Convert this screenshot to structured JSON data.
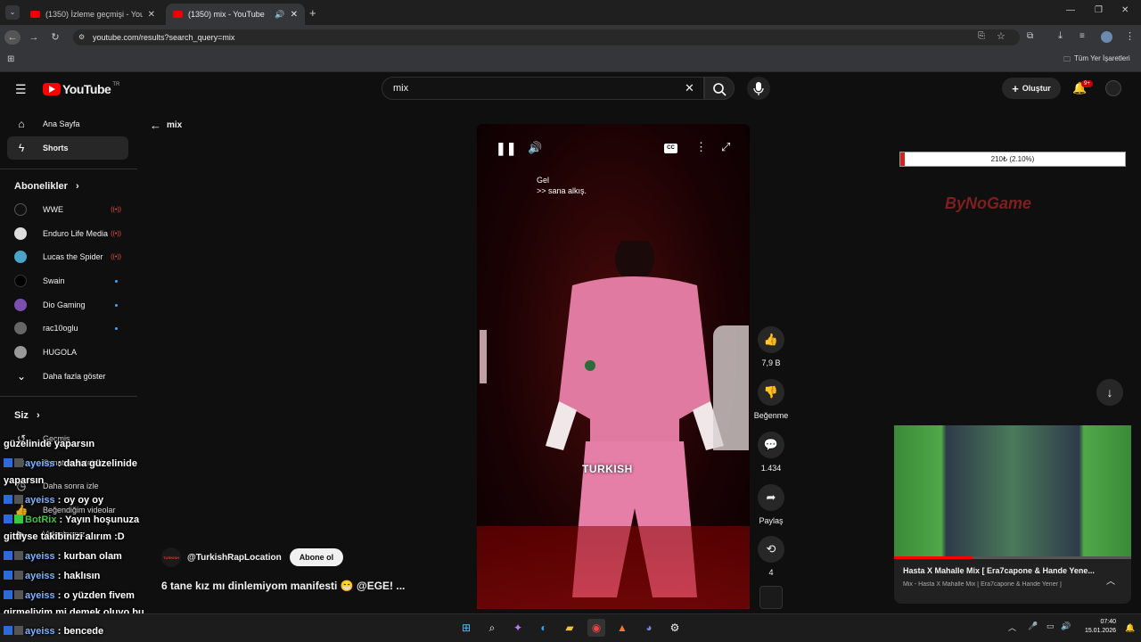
{
  "browser": {
    "tabs": [
      {
        "title": "(1350) İzleme geçmişi - YouTube"
      },
      {
        "title": "(1350) mix - YouTube"
      }
    ],
    "url": "youtube.com/results?search_query=mix",
    "bookmarks_label": "Tüm Yer İşaretleri"
  },
  "header": {
    "logo": "YouTube",
    "region": "TR",
    "search_value": "mix",
    "create_label": "Oluştur",
    "notif_count": "9+"
  },
  "sidebar": {
    "home": "Ana Sayfa",
    "shorts": "Shorts",
    "subs_title": "Abonelikler",
    "subs": [
      {
        "name": "WWE",
        "status": "live"
      },
      {
        "name": "Enduro Life Media",
        "status": "live"
      },
      {
        "name": "Lucas the Spider",
        "status": "live"
      },
      {
        "name": "Swain",
        "status": "new"
      },
      {
        "name": "Dio Gaming",
        "status": "new"
      },
      {
        "name": "rac10oglu",
        "status": "new"
      },
      {
        "name": "HUGOLA",
        "status": ""
      }
    ],
    "more": "Daha fazla göster",
    "you_title": "Siz",
    "you_items": [
      "Geçmiş",
      "Oynatma listeleri",
      "Daha sonra izle",
      "Beğendiğim videolar",
      "Videolarınız"
    ]
  },
  "chat": [
    {
      "user": "",
      "text": "güzelinide yaparsın"
    },
    {
      "user": "ayeiss",
      "text": "daha güzelinide"
    },
    {
      "user": "",
      "text": "yaparsın"
    },
    {
      "user": "ayeiss",
      "text": "oy oy oy"
    },
    {
      "user": "BotRix",
      "text": "Yayın hoşunuza"
    },
    {
      "user": "",
      "text": "gittiyse takibinizi alırım :D"
    },
    {
      "user": "ayeiss",
      "text": "kurban olam"
    },
    {
      "user": "ayeiss",
      "text": "haklısın"
    },
    {
      "user": "ayeiss",
      "text": "o yüzden fivem"
    },
    {
      "user": "",
      "text": "girmeliyim mi demek oluyo bu"
    },
    {
      "user": "ayeiss",
      "text": "bencede"
    }
  ],
  "back_query": "mix",
  "short": {
    "caption_line1": "Gel",
    "caption_line2": ">> sana alkış.",
    "watermark": "TURKISH",
    "channel": "@TurkishRapLocation",
    "subscribe": "Abone ol",
    "title": "6 tane kız mı dinlemiyom manifesti 😁 @EGE! ...",
    "likes": "7,9 B",
    "dislike_label": "Beğenme",
    "comments": "1.434",
    "share_label": "Paylaş",
    "remix_count": "4"
  },
  "overlay": {
    "progress_text": "210₺ (2.10%)",
    "progress_percent": 2.1,
    "brand": "ByNoGame"
  },
  "miniplayer": {
    "title": "Hasta X Mahalle Mix [ Era7capone & Hande Yene...",
    "subtitle": "Mix - Hasta X Mahalle Mix [ Era7capone & Hande Yener ]"
  },
  "taskbar": {
    "time": "07:40",
    "date": "15.01.2026"
  }
}
